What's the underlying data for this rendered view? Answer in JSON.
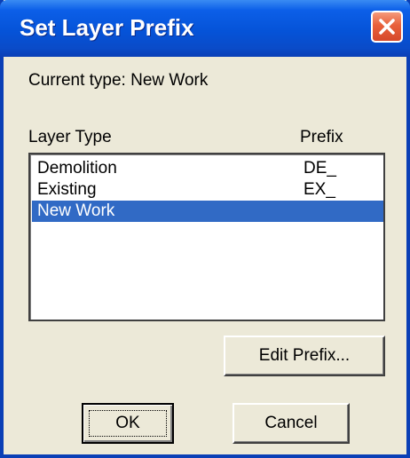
{
  "window": {
    "title": "Set Layer Prefix"
  },
  "current_type_label": "Current type: New Work",
  "list": {
    "column_layer_type": "Layer Type",
    "column_prefix": "Prefix",
    "rows": [
      {
        "layer_type": "Demolition",
        "prefix": "DE_"
      },
      {
        "layer_type": "Existing",
        "prefix": "EX_"
      },
      {
        "layer_type": "New Work",
        "prefix": ""
      }
    ],
    "selected_index": 2
  },
  "buttons": {
    "edit_prefix": "Edit Prefix...",
    "ok": "OK",
    "cancel": "Cancel"
  },
  "colors": {
    "title_bar": "#0553d8",
    "selection": "#316ac5",
    "close_button": "#e8603a",
    "dialog_background": "#ece9d8"
  }
}
